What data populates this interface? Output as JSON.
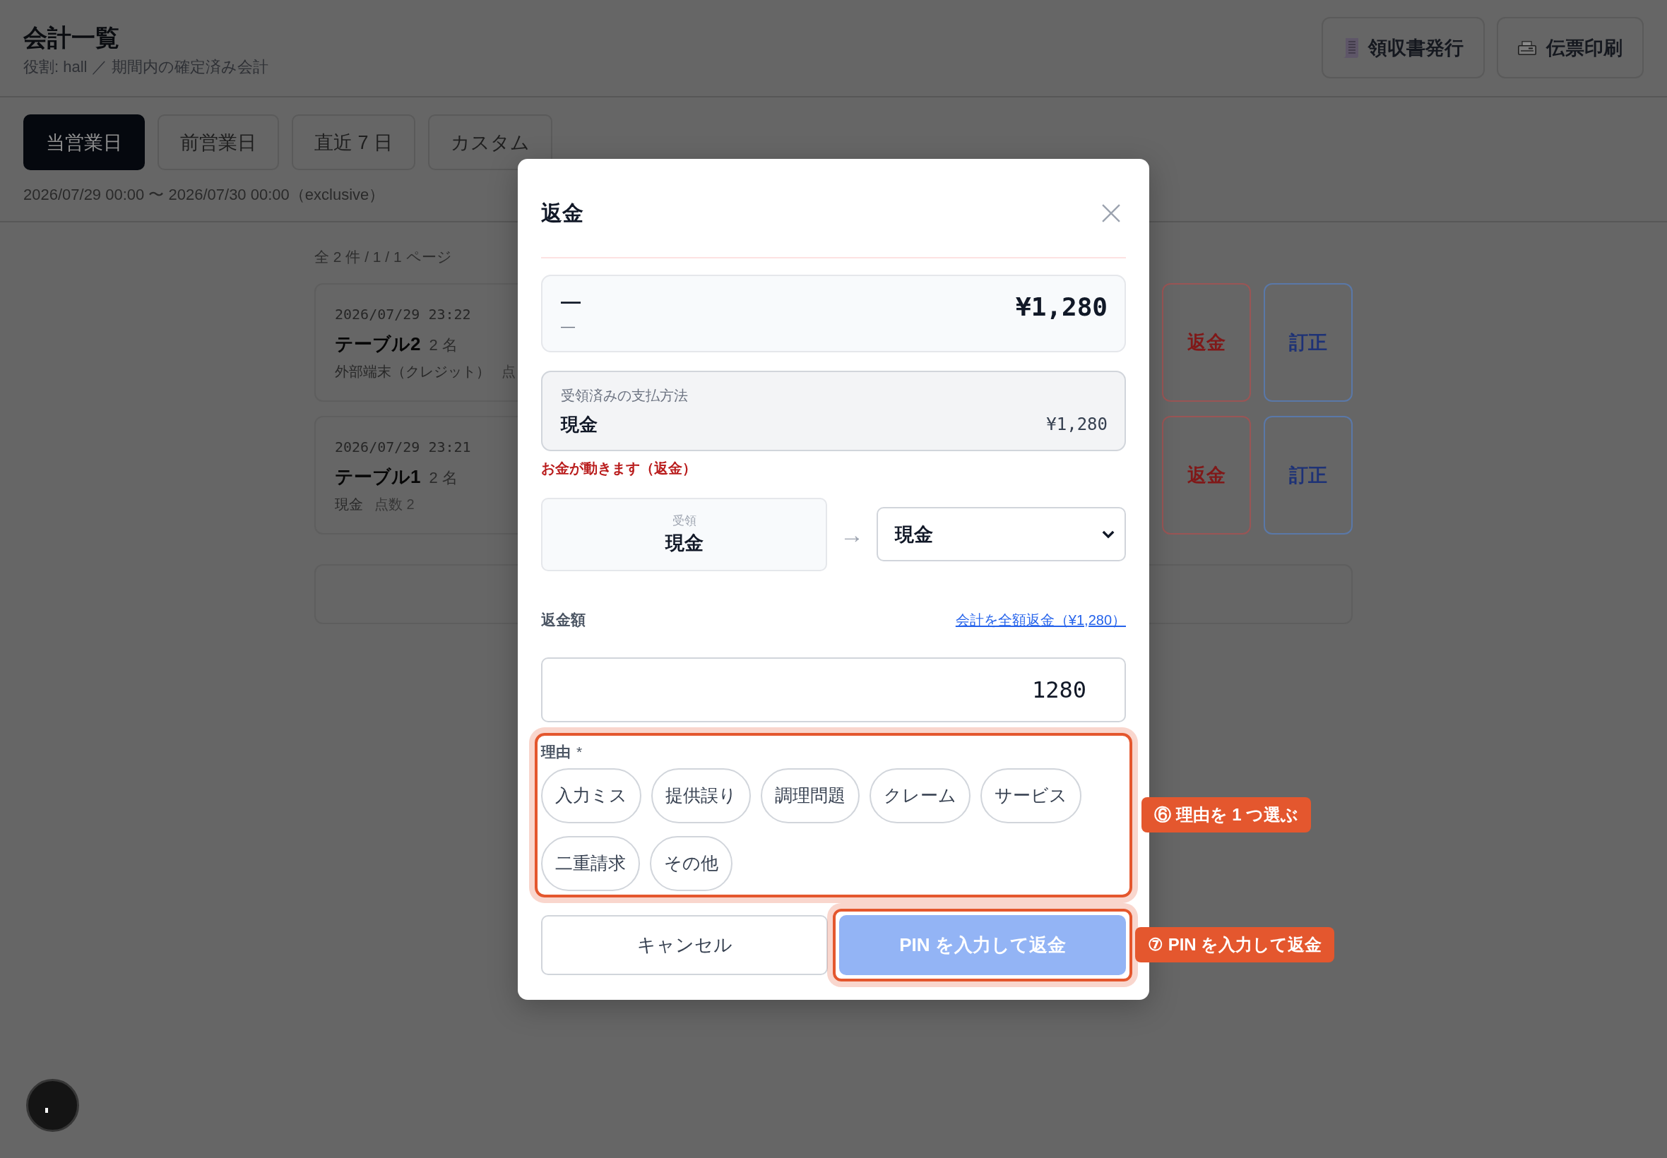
{
  "header": {
    "title": "会計一覧",
    "subtitle": "役割: hall ／ 期間内の確定済み会計",
    "actions": [
      {
        "label": "領収書発行",
        "kind": "receipt"
      },
      {
        "label": "伝票印刷",
        "kind": "print"
      }
    ]
  },
  "period_tabs": [
    {
      "label": "当営業日",
      "selected": true
    },
    {
      "label": "前営業日",
      "selected": false
    },
    {
      "label": "直近 7 日",
      "selected": false
    },
    {
      "label": "カスタム",
      "selected": false
    }
  ],
  "period_range": "2026/07/29 00:00 〜 2026/07/30 00:00（exclusive）",
  "result_count": "全 2 件 / 1 / 1 ページ",
  "payments": [
    {
      "time": "2026/07/29 23:22",
      "table": "テーブル2",
      "guests": "2 名",
      "method": "外部端末（クレジット）",
      "items": "点",
      "actions": [
        {
          "label": "返金",
          "kind": "refund"
        },
        {
          "label": "訂正",
          "kind": "correct"
        }
      ]
    },
    {
      "time": "2026/07/29 23:21",
      "table": "テーブル1",
      "guests": "2 名",
      "method": "現金",
      "items": "点数 2",
      "actions": [
        {
          "label": "返金",
          "kind": "refund"
        },
        {
          "label": "訂正",
          "kind": "correct"
        }
      ]
    }
  ],
  "dialog": {
    "title": "返金",
    "summary": {
      "name": "—",
      "detail": "—",
      "amount": "¥1,280"
    },
    "received": {
      "label": "受領済みの支払方法",
      "method": "現金",
      "amount": "¥1,280"
    },
    "warning": "お金が動きます（返金）",
    "method_change": {
      "from_label": "受領",
      "from": "現金",
      "arrow": "→",
      "to": "現金"
    },
    "amount": {
      "label": "返金額",
      "full_refund_link": "会計を全額返金（¥1,280）",
      "value": "1280"
    },
    "reason": {
      "label": "理由",
      "required_mark": "*",
      "highlighted": true,
      "callout": "⑥ 理由を 1 つ選ぶ",
      "options": [
        {
          "label": "入力ミス",
          "selected": false
        },
        {
          "label": "提供誤り",
          "selected": false
        },
        {
          "label": "調理問題",
          "selected": false
        },
        {
          "label": "クレーム",
          "selected": false
        },
        {
          "label": "サービス",
          "selected": false
        },
        {
          "label": "二重請求",
          "selected": false
        },
        {
          "label": "その他",
          "selected": false
        }
      ]
    },
    "buttons": [
      {
        "label": "キャンセル",
        "kind": "secondary",
        "disabled": false,
        "highlighted": false
      },
      {
        "label": "PIN を入力して返金",
        "kind": "primary",
        "disabled": true,
        "highlighted": true,
        "callout": "⑦ PIN を入力して返金"
      }
    ]
  }
}
